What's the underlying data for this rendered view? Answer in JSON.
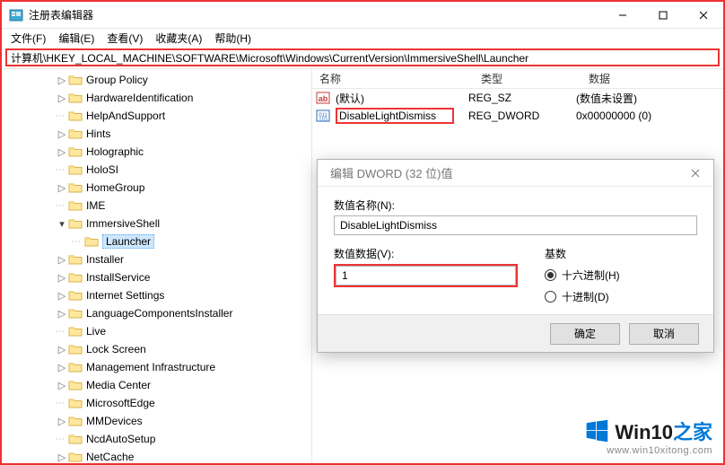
{
  "window": {
    "title": "注册表编辑器",
    "buttons": {
      "min": "–",
      "max": "□",
      "close": "×"
    }
  },
  "menu": {
    "file": "文件(F)",
    "edit": "编辑(E)",
    "view": "查看(V)",
    "fav": "收藏夹(A)",
    "help": "帮助(H)"
  },
  "address": "计算机\\HKEY_LOCAL_MACHINE\\SOFTWARE\\Microsoft\\Windows\\CurrentVersion\\ImmersiveShell\\Launcher",
  "columns": {
    "name": "名称",
    "type": "类型",
    "data": "数据"
  },
  "values": [
    {
      "icon": "string",
      "name": "(默认)",
      "type": "REG_SZ",
      "data": "(数值未设置)"
    },
    {
      "icon": "dword",
      "name": "DisableLightDismiss",
      "type": "REG_DWORD",
      "data": "0x00000000 (0)"
    }
  ],
  "tree": [
    {
      "depth": 4,
      "exp": "closed",
      "label": "Group Policy"
    },
    {
      "depth": 4,
      "exp": "closed",
      "label": "HardwareIdentification"
    },
    {
      "depth": 4,
      "exp": "none",
      "label": "HelpAndSupport"
    },
    {
      "depth": 4,
      "exp": "closed",
      "label": "Hints"
    },
    {
      "depth": 4,
      "exp": "closed",
      "label": "Holographic"
    },
    {
      "depth": 4,
      "exp": "none",
      "label": "HoloSI"
    },
    {
      "depth": 4,
      "exp": "closed",
      "label": "HomeGroup"
    },
    {
      "depth": 4,
      "exp": "none",
      "label": "IME"
    },
    {
      "depth": 4,
      "exp": "open",
      "label": "ImmersiveShell"
    },
    {
      "depth": 5,
      "exp": "none",
      "label": "Launcher",
      "selected": true
    },
    {
      "depth": 4,
      "exp": "closed",
      "label": "Installer"
    },
    {
      "depth": 4,
      "exp": "closed",
      "label": "InstallService"
    },
    {
      "depth": 4,
      "exp": "closed",
      "label": "Internet Settings"
    },
    {
      "depth": 4,
      "exp": "closed",
      "label": "LanguageComponentsInstaller"
    },
    {
      "depth": 4,
      "exp": "none",
      "label": "Live"
    },
    {
      "depth": 4,
      "exp": "closed",
      "label": "Lock Screen"
    },
    {
      "depth": 4,
      "exp": "closed",
      "label": "Management Infrastructure"
    },
    {
      "depth": 4,
      "exp": "closed",
      "label": "Media Center"
    },
    {
      "depth": 4,
      "exp": "none",
      "label": "MicrosoftEdge"
    },
    {
      "depth": 4,
      "exp": "closed",
      "label": "MMDevices"
    },
    {
      "depth": 4,
      "exp": "none",
      "label": "NcdAutoSetup"
    },
    {
      "depth": 4,
      "exp": "closed",
      "label": "NetCache"
    }
  ],
  "dialog": {
    "title": "编辑 DWORD (32 位)值",
    "nameLabel": "数值名称(N):",
    "nameValue": "DisableLightDismiss",
    "dataLabel": "数值数据(V):",
    "dataValue": "1",
    "baseLabel": "基数",
    "hex": "十六进制(H)",
    "dec": "十进制(D)",
    "ok": "确定",
    "cancel": "取消"
  },
  "watermark": {
    "brand1": "Win10",
    "brand2": "之家",
    "url": "www.win10xitong.com"
  }
}
